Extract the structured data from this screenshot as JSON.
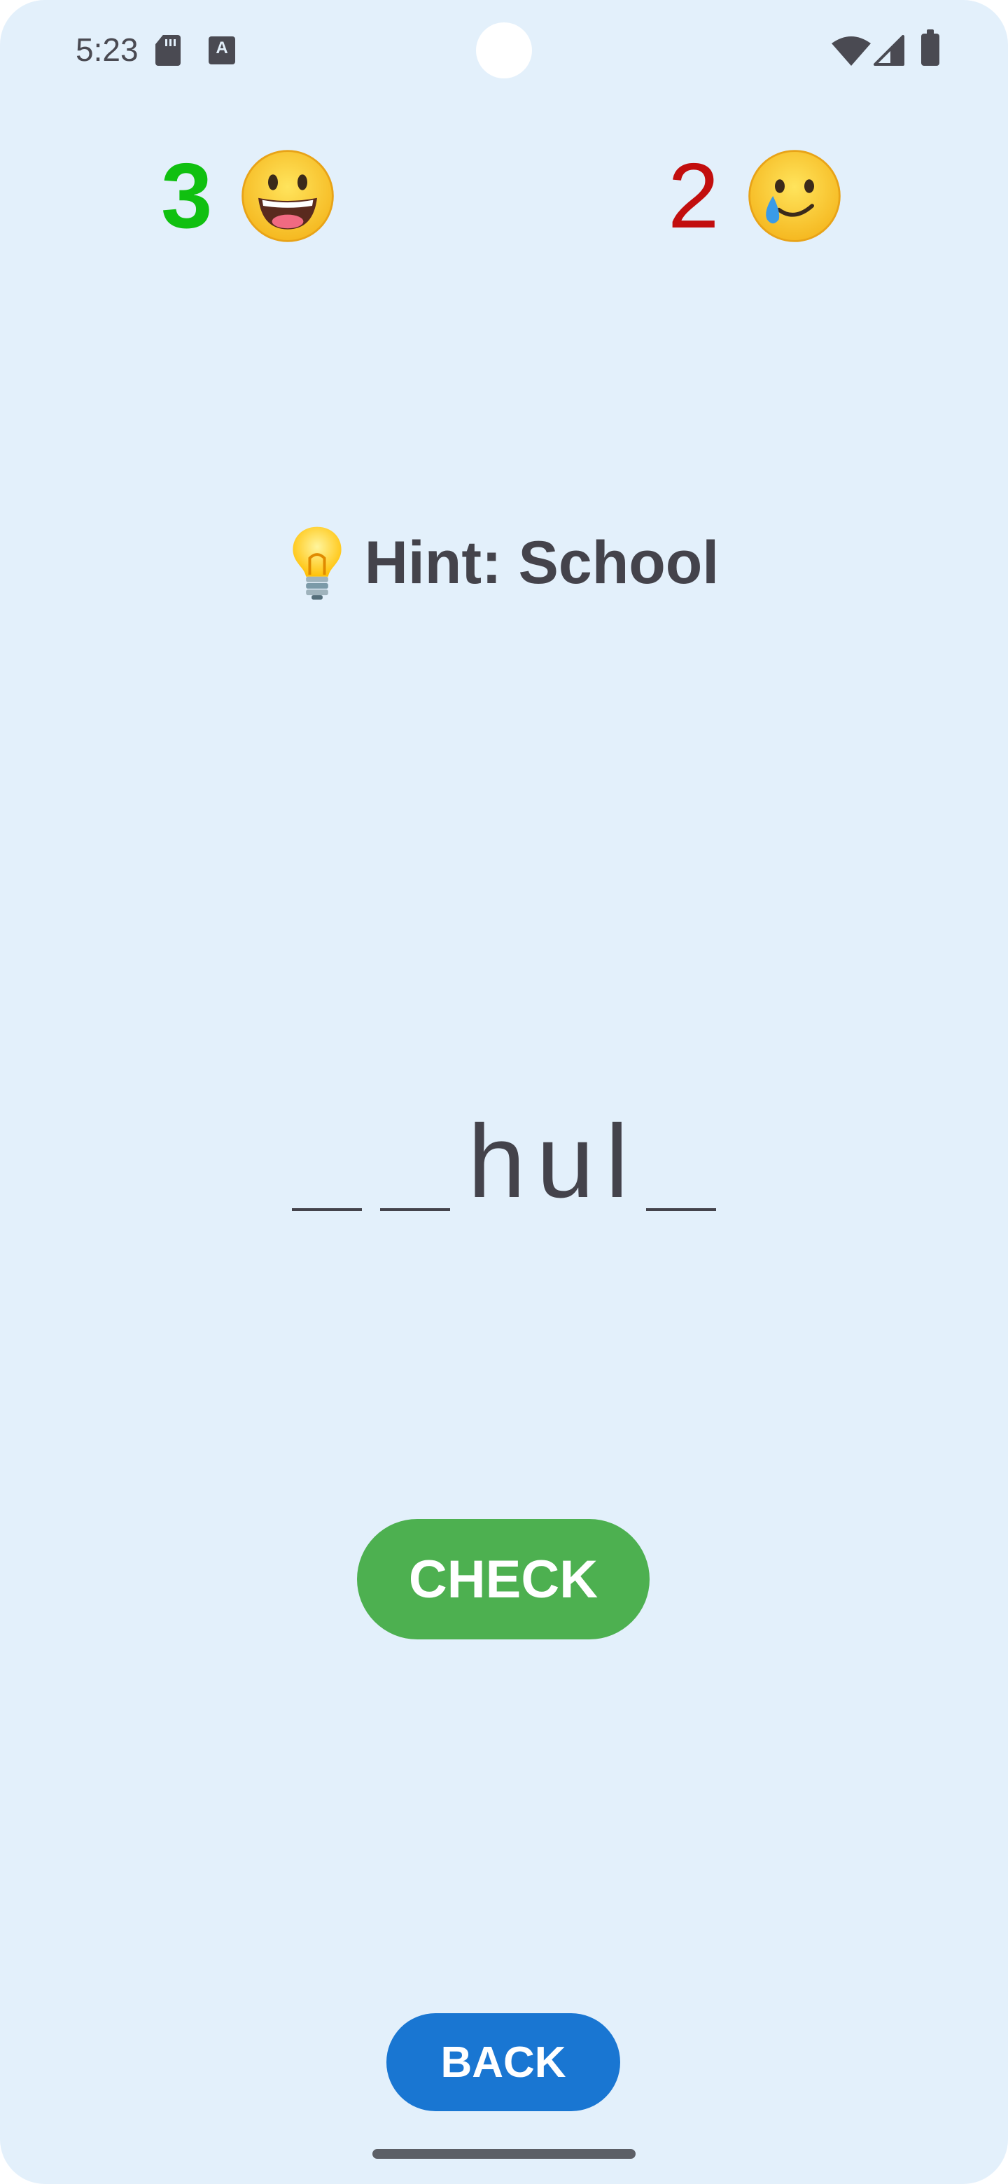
{
  "status_bar": {
    "time": "5:23",
    "icons": [
      "sd-card-icon",
      "keyboard-a-icon",
      "wifi-icon",
      "signal-icon",
      "battery-icon"
    ]
  },
  "scores": {
    "correct": {
      "value": "3",
      "emoji": "grinning-face-icon",
      "color": "#10c010"
    },
    "wrong": {
      "value": "2",
      "emoji": "smiling-face-with-tear-icon",
      "color": "#c20e0e"
    }
  },
  "hint": {
    "icon": "lightbulb-icon",
    "text": "Hint: School"
  },
  "puzzle": {
    "slots": [
      "",
      "",
      "h",
      "u",
      "l",
      ""
    ]
  },
  "buttons": {
    "check": "CHECK",
    "back": "BACK"
  },
  "colors": {
    "background": "#e3f0fb",
    "check_button": "#4db050",
    "back_button": "#1976d2",
    "text": "#44434b"
  }
}
